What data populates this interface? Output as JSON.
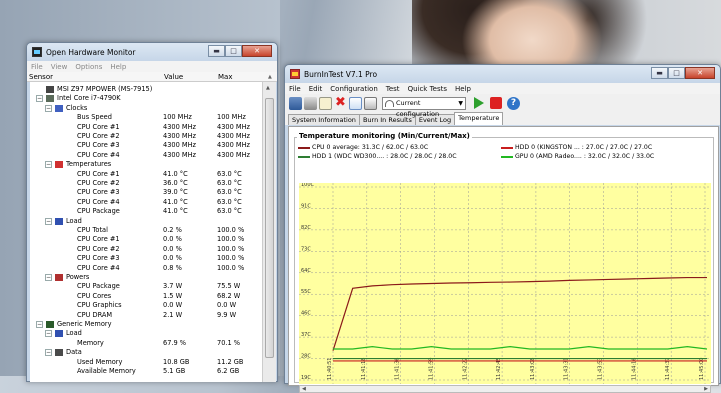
{
  "ohm": {
    "title": "Open Hardware Monitor",
    "menu": [
      "File",
      "View",
      "Options",
      "Help"
    ],
    "columns": {
      "sensor": "Sensor",
      "value": "Value",
      "max": "Max"
    },
    "rows": [
      {
        "label": "MSI Z97 MPOWER (MS-7915)",
        "value": "",
        "max": "",
        "indent": 1,
        "icon": "motherboard",
        "expand": false
      },
      {
        "label": "Intel Core i7-4790K",
        "value": "",
        "max": "",
        "indent": 1,
        "icon": "cpu",
        "expand": true
      },
      {
        "label": "Clocks",
        "value": "",
        "max": "",
        "indent": 2,
        "icon": "clock",
        "expand": true
      },
      {
        "label": "Bus Speed",
        "value": "100 MHz",
        "max": "100 MHz",
        "indent": 3
      },
      {
        "label": "CPU Core #1",
        "value": "4300 MHz",
        "max": "4300 MHz",
        "indent": 3
      },
      {
        "label": "CPU Core #2",
        "value": "4300 MHz",
        "max": "4300 MHz",
        "indent": 3
      },
      {
        "label": "CPU Core #3",
        "value": "4300 MHz",
        "max": "4300 MHz",
        "indent": 3
      },
      {
        "label": "CPU Core #4",
        "value": "4300 MHz",
        "max": "4300 MHz",
        "indent": 3
      },
      {
        "label": "Temperatures",
        "value": "",
        "max": "",
        "indent": 2,
        "icon": "thermometer",
        "expand": true
      },
      {
        "label": "CPU Core #1",
        "value": "41.0 °C",
        "max": "63.0 °C",
        "indent": 3
      },
      {
        "label": "CPU Core #2",
        "value": "36.0 °C",
        "max": "63.0 °C",
        "indent": 3
      },
      {
        "label": "CPU Core #3",
        "value": "39.0 °C",
        "max": "63.0 °C",
        "indent": 3
      },
      {
        "label": "CPU Core #4",
        "value": "41.0 °C",
        "max": "63.0 °C",
        "indent": 3
      },
      {
        "label": "CPU Package",
        "value": "41.0 °C",
        "max": "63.0 °C",
        "indent": 3
      },
      {
        "label": "Load",
        "value": "",
        "max": "",
        "indent": 2,
        "icon": "load",
        "expand": true
      },
      {
        "label": "CPU Total",
        "value": "0.2 %",
        "max": "100.0 %",
        "indent": 3
      },
      {
        "label": "CPU Core #1",
        "value": "0.0 %",
        "max": "100.0 %",
        "indent": 3
      },
      {
        "label": "CPU Core #2",
        "value": "0.0 %",
        "max": "100.0 %",
        "indent": 3
      },
      {
        "label": "CPU Core #3",
        "value": "0.0 %",
        "max": "100.0 %",
        "indent": 3
      },
      {
        "label": "CPU Core #4",
        "value": "0.8 %",
        "max": "100.0 %",
        "indent": 3
      },
      {
        "label": "Powers",
        "value": "",
        "max": "",
        "indent": 2,
        "icon": "power",
        "expand": true
      },
      {
        "label": "CPU Package",
        "value": "3.7 W",
        "max": "75.5 W",
        "indent": 3
      },
      {
        "label": "CPU Cores",
        "value": "1.5 W",
        "max": "68.2 W",
        "indent": 3
      },
      {
        "label": "CPU Graphics",
        "value": "0.0 W",
        "max": "0.0 W",
        "indent": 3
      },
      {
        "label": "CPU DRAM",
        "value": "2.1 W",
        "max": "9.9 W",
        "indent": 3
      },
      {
        "label": "Generic Memory",
        "value": "",
        "max": "",
        "indent": 1,
        "icon": "memory",
        "expand": true
      },
      {
        "label": "Load",
        "value": "",
        "max": "",
        "indent": 2,
        "icon": "load",
        "expand": true
      },
      {
        "label": "Memory",
        "value": "67.9 %",
        "max": "70.1 %",
        "indent": 3
      },
      {
        "label": "Data",
        "value": "",
        "max": "",
        "indent": 2,
        "icon": "data",
        "expand": true
      },
      {
        "label": "Used Memory",
        "value": "10.8 GB",
        "max": "11.2 GB",
        "indent": 3
      },
      {
        "label": "Available Memory",
        "value": "5.1 GB",
        "max": "6.2 GB",
        "indent": 3
      }
    ]
  },
  "bit": {
    "title": "BurnInTest V7.1 Pro",
    "menu": [
      "File",
      "Edit",
      "Configuration",
      "Test",
      "Quick Tests",
      "Help"
    ],
    "config": "Current configuration",
    "tabs": [
      "System Information",
      "Burn In Results",
      "Event Log",
      "Temperature"
    ],
    "active_tab": 3,
    "panel_title": "Temperature monitoring  (Min/Current/Max)",
    "legend": [
      {
        "text": "CPU 0 average: 31.3C / 62.0C / 63.0C",
        "color": "#8b1a1a"
      },
      {
        "text": "HDD 0 (KINGSTON ... : 27.0C / 27.0C / 27.0C",
        "color": "#c81e1e"
      },
      {
        "text": "HDD 1 (WDC WD300.... : 28.0C / 28.0C / 28.0C",
        "color": "#2e7d32"
      },
      {
        "text": "GPU 0 (AMD Radeo.... : 32.0C / 32.0C / 33.0C",
        "color": "#22b822"
      }
    ]
  },
  "chart_data": {
    "type": "line",
    "title": "Temperature monitoring  (Min/Current/Max)",
    "background": "#ffffa0",
    "ylim": [
      20,
      100
    ],
    "y_ticks": [
      "19C",
      "28C",
      "37C",
      "46C",
      "55C",
      "64C",
      "73C",
      "82C",
      "91C",
      "100C"
    ],
    "x_ticks": [
      "11:40:51",
      "11:41:18",
      "11:41:36",
      "11:41:59",
      "11:42:22",
      "11:42:45",
      "11:43:08",
      "11:43:31",
      "11:43:53",
      "11:44:16",
      "11:44:37",
      "11:45:00"
    ],
    "series": [
      {
        "name": "CPU 0",
        "color": "#8b1a1a",
        "values": [
          31.3,
          57.5,
          58.5,
          59.0,
          59.3,
          59.5,
          59.7,
          59.8,
          60.0,
          60.1,
          60.3,
          60.5,
          60.8,
          61.0,
          61.2,
          61.4,
          61.6,
          61.8,
          62.0,
          62.0
        ]
      },
      {
        "name": "HDD 0",
        "color": "#c81e1e",
        "values": [
          27,
          27,
          27,
          27,
          27,
          27,
          27,
          27,
          27,
          27,
          27,
          27,
          27,
          27,
          27,
          27,
          27,
          27,
          27,
          27
        ]
      },
      {
        "name": "HDD 1",
        "color": "#2e7d32",
        "values": [
          28,
          28,
          28,
          28,
          28,
          28,
          28,
          28,
          28,
          28,
          28,
          28,
          28,
          28,
          28,
          28,
          28,
          28,
          28,
          28
        ]
      },
      {
        "name": "GPU 0",
        "color": "#22b822",
        "values": [
          32,
          32,
          33,
          32,
          32,
          33,
          32,
          32,
          32,
          33,
          32,
          32,
          32,
          33,
          32,
          32,
          32,
          32,
          33,
          32
        ]
      }
    ]
  }
}
